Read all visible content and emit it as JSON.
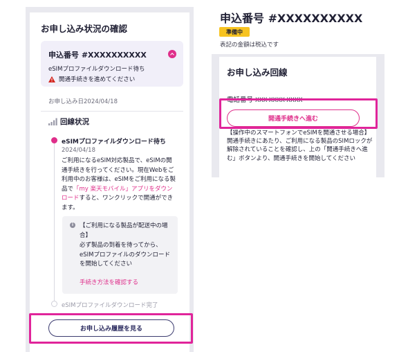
{
  "left": {
    "section_title": "お申し込み状況の確認",
    "order": {
      "number": "申込番号 #XXXXXXXXXX",
      "state": "eSIMプロファイルダウンロード待ち",
      "alert": "開通手続きを進めてください"
    },
    "apply_date": "お申し込み日2024/04/18",
    "line_status_label": "回線状況",
    "current_step": {
      "title": "eSIMプロファイルダウンロード待ち",
      "date": "2024/04/18",
      "body_pre": "ご利用になるeSIM対応製品で、eSIMの開通手続きを行ってください。現在Webをご利用中のお客様は、eSIMをご利用になる製品で",
      "body_link": "「my 楽天モバイル」アプリをダウンロード",
      "body_post": "すると、ワンクリックで開通ができます。"
    },
    "notice": {
      "info_glyph": "i",
      "title": "【ご利用になる製品が配送中の場合】",
      "body": "必ず製品の到着を待ってから、eSIMプロファイルのダウンロードを開始してください",
      "link": "手続き方法を確認する"
    },
    "next_step": "eSIMプロファイルダウンロード完了",
    "history_button": "お申し込み履歴を見る"
  },
  "right": {
    "order_number": "申込番号 #XXXXXXXXXX",
    "badge": "準備中",
    "tax_note": "表記の金額は税込です",
    "card_title": "お申し込み回線",
    "phone_label": "電話番号",
    "phone_value": "XXX-XXXX-XXXX",
    "open_button": "開通手続きへ進む",
    "body": "【操作中のスマートフォンでeSIMを開通させる場合】開通手続きにあたり、ご利用になる製品のSIMロックが解除されていることを確認し、上の「開通手続きへ進む」ボタンより、開通手続きを開始してください"
  },
  "colors": {
    "accent": "#df2e8a",
    "highlight": "#e0249a",
    "badge": "#f7c320",
    "navy": "#2a2a5e",
    "panel_bg": "#e9e9ef"
  },
  "icons": [
    "chevron-up-icon",
    "warning-icon",
    "signal-bars-icon",
    "info-icon"
  ]
}
